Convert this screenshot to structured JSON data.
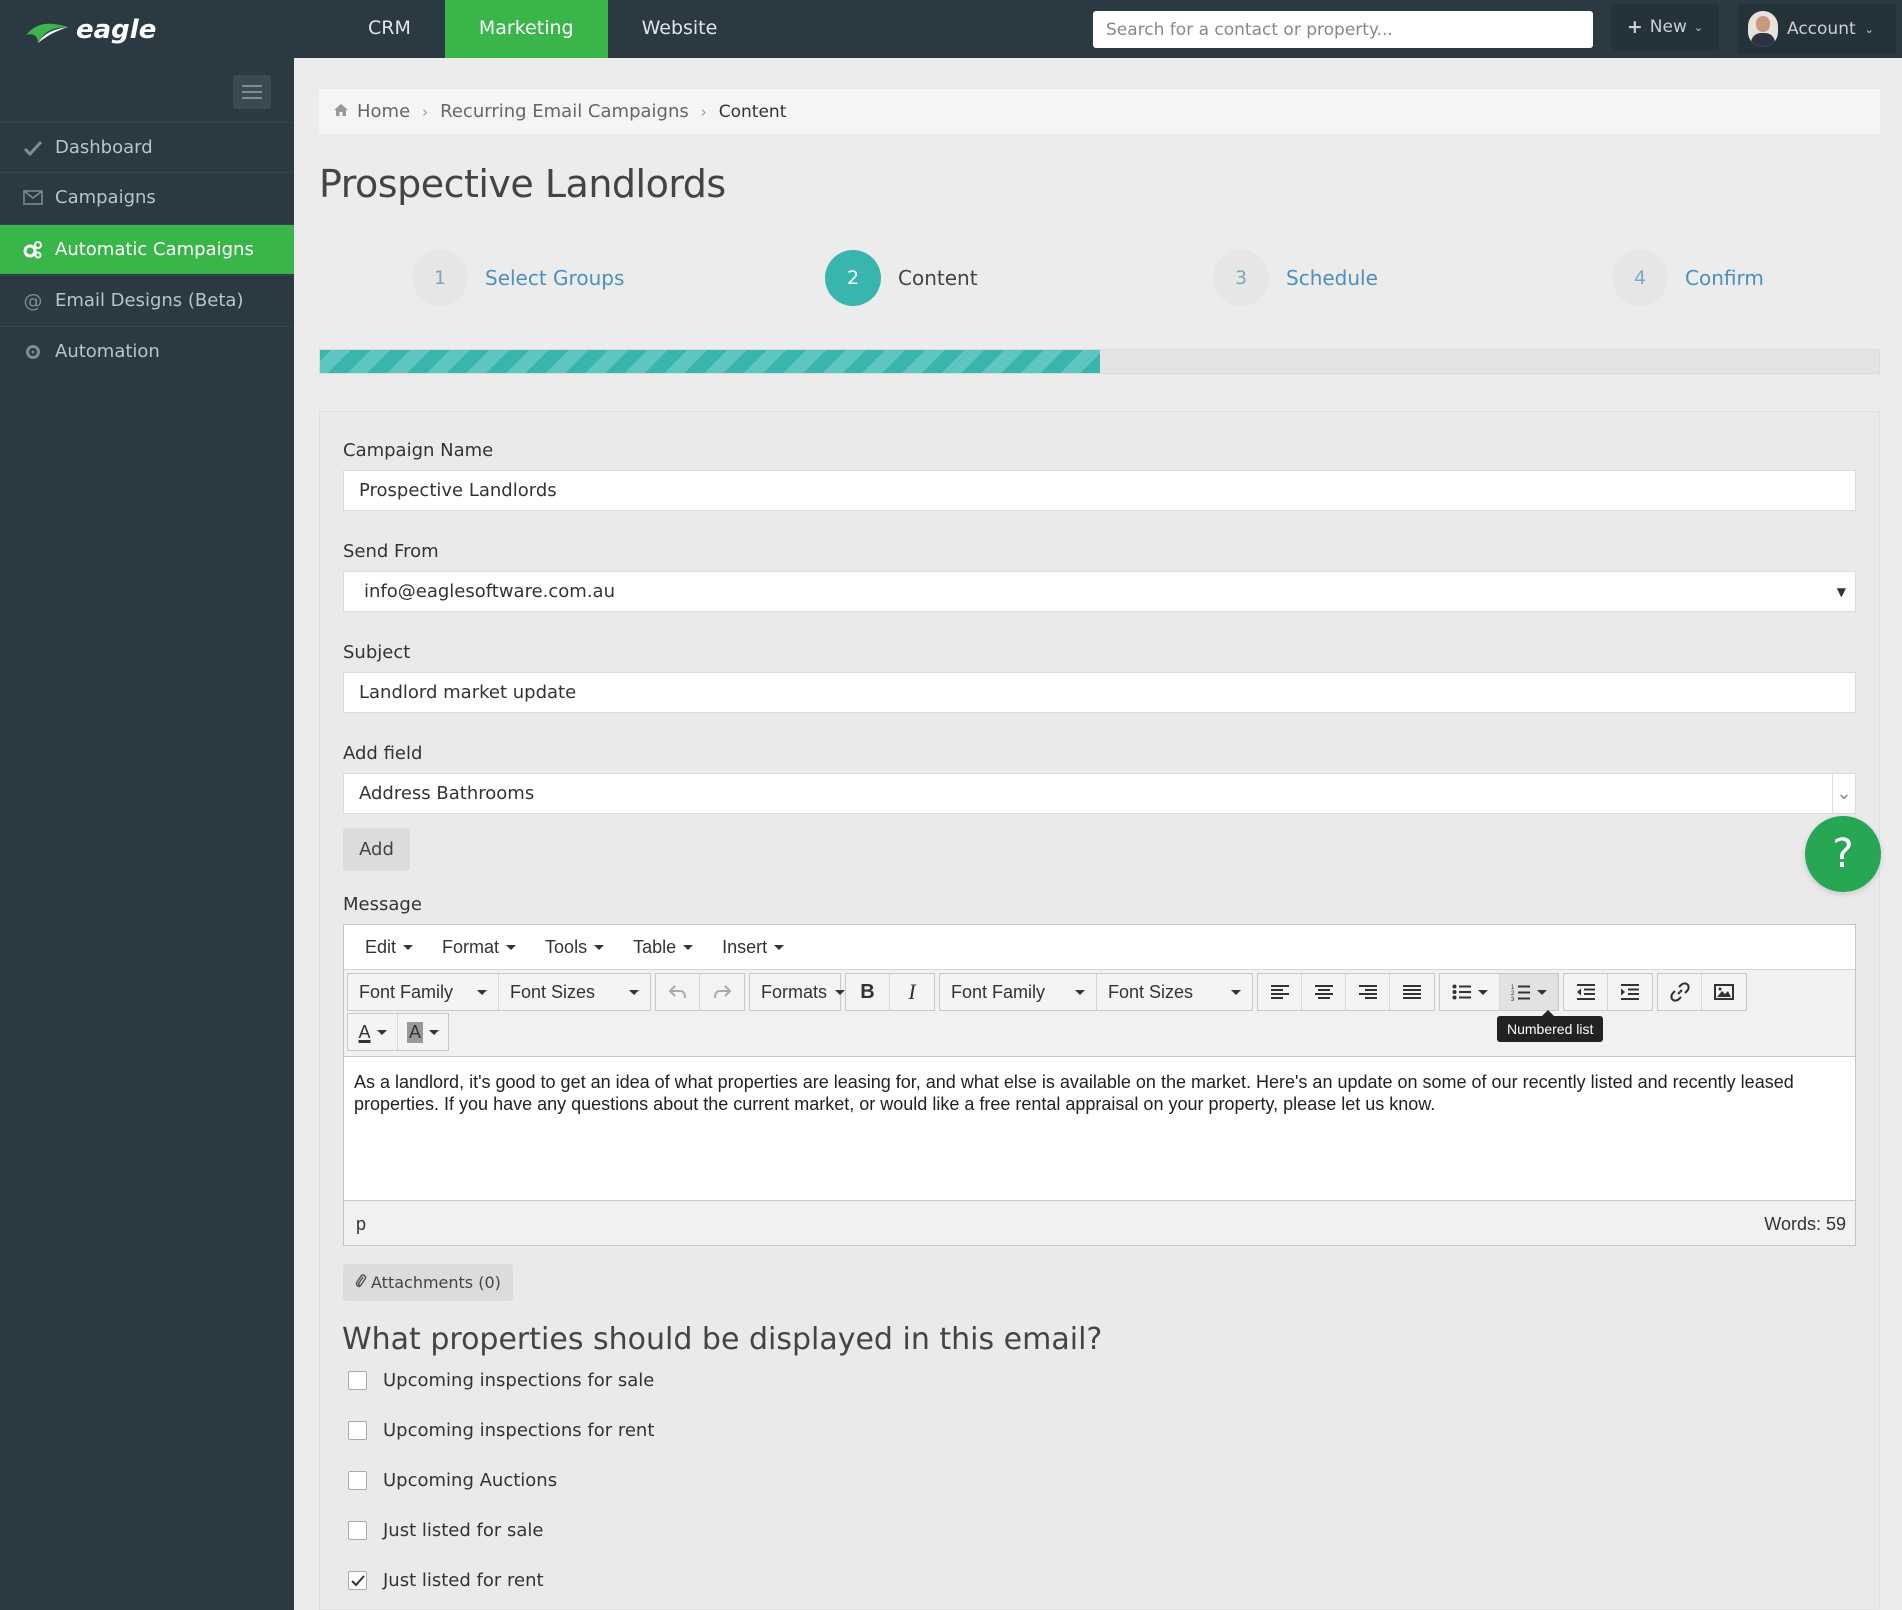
{
  "app": {
    "logo_text": "eagle",
    "top_tabs": [
      {
        "label": "CRM"
      },
      {
        "label": "Marketing"
      },
      {
        "label": "Website"
      }
    ],
    "search_placeholder": "Search for a contact or property...",
    "new_label": "New",
    "account_label": "Account",
    "accent_color": "#3ab54a",
    "teal_color": "#3ab5ad"
  },
  "sidebar": {
    "items": [
      {
        "label": "Dashboard",
        "icon": "check-icon"
      },
      {
        "label": "Campaigns",
        "icon": "envelope-icon"
      },
      {
        "label": "Automatic Campaigns",
        "icon": "gears-icon"
      },
      {
        "label": "Email Designs (Beta)",
        "icon": "at-icon"
      },
      {
        "label": "Automation",
        "icon": "gear-icon"
      }
    ],
    "active_index": 2
  },
  "breadcrumb": {
    "home": "Home",
    "parent": "Recurring Email Campaigns",
    "current": "Content"
  },
  "page": {
    "title": "Prospective Landlords",
    "steps": [
      {
        "num": "1",
        "label": "Select Groups"
      },
      {
        "num": "2",
        "label": "Content"
      },
      {
        "num": "3",
        "label": "Schedule"
      },
      {
        "num": "4",
        "label": "Confirm"
      }
    ],
    "current_step": 2,
    "progress": 0.5
  },
  "form": {
    "campaign_name_label": "Campaign Name",
    "campaign_name_value": "Prospective Landlords",
    "send_from_label": "Send From",
    "send_from_value": "info@eaglesoftware.com.au",
    "subject_label": "Subject",
    "subject_value": "Landlord market update",
    "add_field_label": "Add field",
    "add_field_value": "Address Bathrooms",
    "add_button": "Add",
    "message_label": "Message",
    "attachments_label": "Attachments (0)",
    "help_label": "?"
  },
  "editor": {
    "menus": [
      "Edit",
      "Format",
      "Tools",
      "Table",
      "Insert"
    ],
    "font_family": "Font Family",
    "font_sizes": "Font Sizes",
    "formats": "Formats",
    "bold": "B",
    "italic": "I",
    "text_color": "A",
    "bg_color": "A",
    "tooltip": "Numbered list",
    "content": "As a landlord, it's good to get an idea of what properties are leasing for, and what else is available on the market. Here's an update on some of our recently listed and recently leased properties. If you have any questions about the current market, or would like a free rental appraisal on your property, please let us know.",
    "path": "p",
    "word_count": "Words: 59"
  },
  "properties": {
    "title": "What properties should be displayed in this email?",
    "options": [
      {
        "label": "Upcoming inspections for sale",
        "checked": false
      },
      {
        "label": "Upcoming inspections for rent",
        "checked": false
      },
      {
        "label": "Upcoming Auctions",
        "checked": false
      },
      {
        "label": "Just listed for sale",
        "checked": false
      },
      {
        "label": "Just listed for rent",
        "checked": true
      }
    ]
  }
}
